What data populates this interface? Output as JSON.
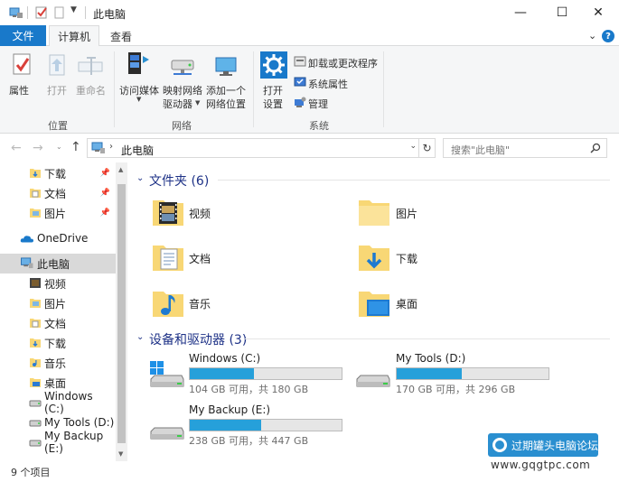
{
  "titlebar": {
    "title": "此电脑",
    "minimize": "—",
    "maximize": "☐",
    "close": "✕"
  },
  "tabs": {
    "file": "文件",
    "computer": "计算机",
    "view": "查看"
  },
  "ribbon": {
    "properties": "属性",
    "open": "打开",
    "rename": "重命名",
    "group_location": "位置",
    "access_media": "访问媒体",
    "map_drive_1": "映射网络",
    "map_drive_2": "驱动器",
    "add_location_1": "添加一个",
    "add_location_2": "网络位置",
    "group_network": "网络",
    "open_settings_1": "打开",
    "open_settings_2": "设置",
    "uninstall": "卸载或更改程序",
    "system_properties": "系统属性",
    "manage": "管理",
    "group_system": "系统"
  },
  "nav": {
    "path": "此电脑",
    "search_placeholder": "搜索\"此电脑\""
  },
  "sidebar": {
    "items": [
      {
        "label": "下载"
      },
      {
        "label": "文档"
      },
      {
        "label": "图片"
      },
      {
        "label": "OneDrive"
      },
      {
        "label": "此电脑"
      },
      {
        "label": "视频"
      },
      {
        "label": "图片"
      },
      {
        "label": "文档"
      },
      {
        "label": "下载"
      },
      {
        "label": "音乐"
      },
      {
        "label": "桌面"
      },
      {
        "label": "Windows (C:)"
      },
      {
        "label": "My Tools (D:)"
      },
      {
        "label": "My Backup (E:)"
      }
    ]
  },
  "main": {
    "folders_header": "文件夹 (6)",
    "folders": [
      {
        "label": "视频"
      },
      {
        "label": "图片"
      },
      {
        "label": "文档"
      },
      {
        "label": "下载"
      },
      {
        "label": "音乐"
      },
      {
        "label": "桌面"
      }
    ],
    "drives_header": "设备和驱动器 (3)",
    "drives": [
      {
        "name": "Windows (C:)",
        "free": "104 GB 可用，共 180 GB",
        "used_fraction": 0.42
      },
      {
        "name": "My Tools (D:)",
        "free": "170 GB 可用，共 296 GB",
        "used_fraction": 0.43
      },
      {
        "name": "My Backup (E:)",
        "free": "238 GB 可用，共 447 GB",
        "used_fraction": 0.47
      }
    ]
  },
  "status": {
    "count": "9 个项目"
  },
  "watermark": {
    "text": "过期罐头电脑论坛",
    "url": "www.gqgtpc.com"
  },
  "colors": {
    "accent": "#1979ca",
    "drive_fill": "#26a0da",
    "section_header": "#1e3287",
    "folder_yellow": "#f8d775"
  }
}
